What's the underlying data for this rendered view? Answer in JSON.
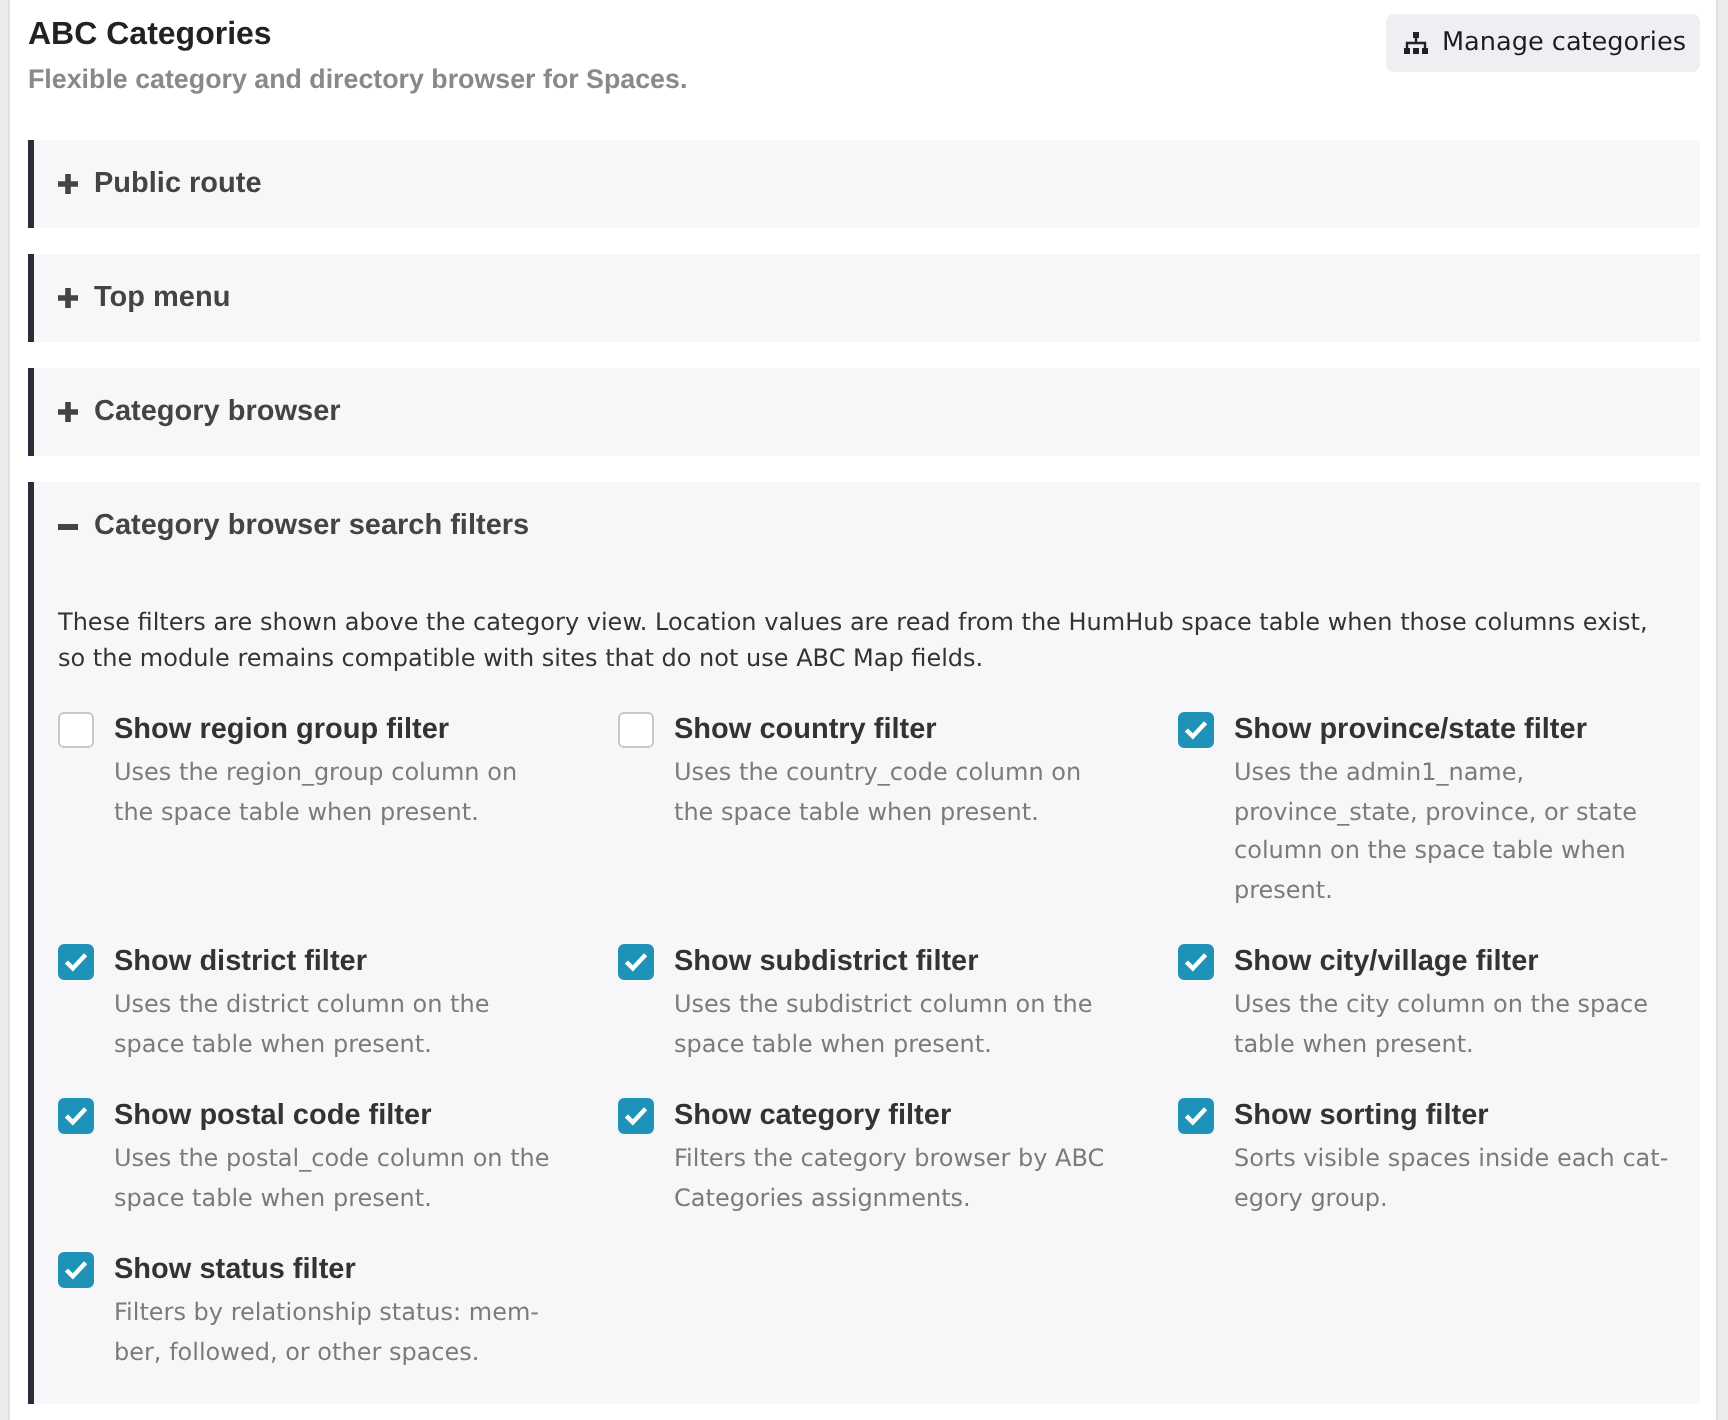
{
  "header": {
    "title": "ABC Categories",
    "subtitle": "Flexible category and directory browser for Spaces.",
    "button": "Manage categories"
  },
  "sections": [
    {
      "title": "Public route",
      "expanded": false
    },
    {
      "title": "Top menu",
      "expanded": false
    },
    {
      "title": "Category browser",
      "expanded": false
    },
    {
      "title": "Category browser search filters",
      "expanded": true,
      "intro": "These filters are shown above the category view. Location values are read from the HumHub space table when those columns exist, so the module remains compatible with sites that do not use ABC Map fields.",
      "options": [
        {
          "label": "Show region group filter",
          "description": "Uses the region_group column on the space table when present.",
          "checked": false
        },
        {
          "label": "Show country filter",
          "description": "Uses the country_code column on the space table when present.",
          "checked": false
        },
        {
          "label": "Show province/state filter",
          "description": "Uses the admin1_name, province_state, province, or state column on the space table when present.",
          "checked": true
        },
        {
          "label": "Show district filter",
          "description": "Uses the district column on the space table when present.",
          "checked": true
        },
        {
          "label": "Show subdistrict filter",
          "description": "Uses the subdistrict column on the space table when present.",
          "checked": true
        },
        {
          "label": "Show city/village filter",
          "description": "Uses the city column on the space table when present.",
          "checked": true
        },
        {
          "label": "Show postal code filter",
          "description": "Uses the postal_code column on the space table when present.",
          "checked": true
        },
        {
          "label": "Show category filter",
          "description": "Filters the category browser by ABC Categories assignments.",
          "checked": true
        },
        {
          "label": "Show sorting filter",
          "description": "Sorts visible spaces inside each cat-egory group.",
          "checked": true
        },
        {
          "label": "Show status filter",
          "description": "Filters by relationship status: mem-ber, followed, or other spaces.",
          "checked": true
        }
      ]
    }
  ]
}
